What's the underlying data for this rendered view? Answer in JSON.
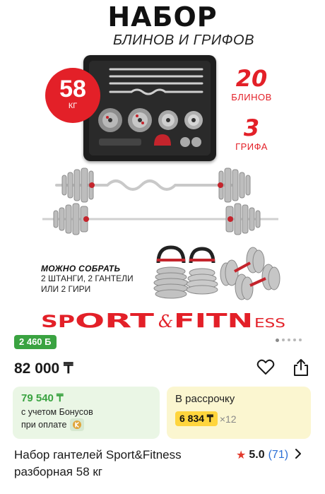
{
  "banner": {
    "title": "НАБОР",
    "subtitle": "БЛИНОВ И ГРИФОВ",
    "weight_value": "58",
    "weight_unit": "КГ",
    "plates_count": "20",
    "plates_label": "БЛИНОВ",
    "bars_count": "3",
    "bars_label": "ГРИФА",
    "can_build_heading": "МОЖНО СОБРАТЬ",
    "can_build_line1": "2 ШТАНГИ, 2 ГАНТЕЛИ",
    "can_build_line2": "ИЛИ 2 ГИРИ",
    "brand_logo_text": "SPORT & FITNESS"
  },
  "carousel": {
    "cashback": "2 460 Б",
    "total_slides": 5,
    "active_slide": 1
  },
  "price": {
    "main": "82 000 ₸"
  },
  "actions": {
    "favorite_icon": "heart-icon",
    "share_icon": "share-icon"
  },
  "bonus_card": {
    "price": "79 540 ₸",
    "line1": "с учетом Бонусов",
    "line2": "при оплате"
  },
  "installment_card": {
    "label": "В рассрочку",
    "amount": "6 834 ₸",
    "multiplier": "×12"
  },
  "product": {
    "title": "Набор гантелей Sport&Fitness разборная 58 кг",
    "rating": "5.0",
    "reviews": "(71)"
  },
  "colors": {
    "brand_red": "#e32028",
    "green": "#3aa341",
    "yellow": "#ffd53d",
    "link_blue": "#2b6fd6"
  }
}
